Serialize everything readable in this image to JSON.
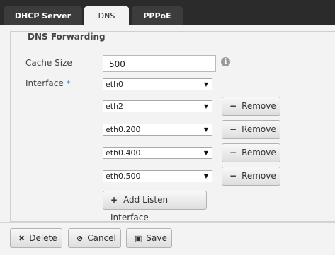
{
  "tabs": [
    {
      "label": "DHCP Server"
    },
    {
      "label": "DNS"
    },
    {
      "label": "PPPoE"
    }
  ],
  "dns_forwarding": {
    "legend": "DNS Forwarding",
    "cache_size_label": "Cache Size",
    "cache_size_value": "500",
    "info_glyph": "i",
    "interface_label": "Interface",
    "required_marker": "*",
    "interfaces": [
      {
        "value": "eth0"
      },
      {
        "value": "eth2"
      },
      {
        "value": "eth0.200"
      },
      {
        "value": "eth0.400"
      },
      {
        "value": "eth0.500"
      }
    ],
    "remove_label": "Remove",
    "remove_icon": "minus-icon",
    "add_listen_label": "Add Listen Interface",
    "add_icon": "plus-icon"
  },
  "footer": {
    "delete_label": "Delete",
    "cancel_label": "Cancel",
    "save_label": "Save"
  },
  "colors": {
    "tab_bar": "#2b2b2b",
    "tab_inactive": "#3c3c3c",
    "panel_bg": "#f3f3f3",
    "required_star": "#4a86c5"
  }
}
